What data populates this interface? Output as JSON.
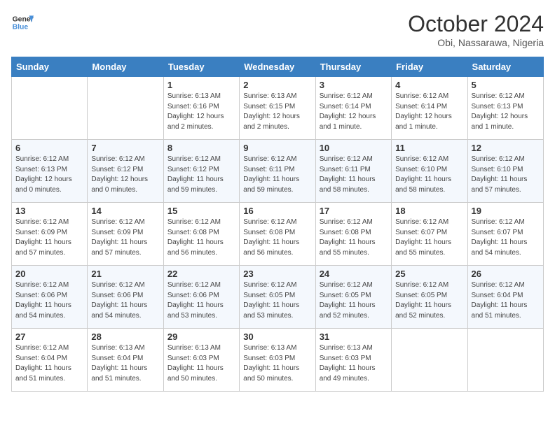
{
  "header": {
    "logo_line1": "General",
    "logo_line2": "Blue",
    "month": "October 2024",
    "location": "Obi, Nassarawa, Nigeria"
  },
  "days_of_week": [
    "Sunday",
    "Monday",
    "Tuesday",
    "Wednesday",
    "Thursday",
    "Friday",
    "Saturday"
  ],
  "weeks": [
    [
      {
        "day": "",
        "info": ""
      },
      {
        "day": "",
        "info": ""
      },
      {
        "day": "1",
        "info": "Sunrise: 6:13 AM\nSunset: 6:16 PM\nDaylight: 12 hours\nand 2 minutes."
      },
      {
        "day": "2",
        "info": "Sunrise: 6:13 AM\nSunset: 6:15 PM\nDaylight: 12 hours\nand 2 minutes."
      },
      {
        "day": "3",
        "info": "Sunrise: 6:12 AM\nSunset: 6:14 PM\nDaylight: 12 hours\nand 1 minute."
      },
      {
        "day": "4",
        "info": "Sunrise: 6:12 AM\nSunset: 6:14 PM\nDaylight: 12 hours\nand 1 minute."
      },
      {
        "day": "5",
        "info": "Sunrise: 6:12 AM\nSunset: 6:13 PM\nDaylight: 12 hours\nand 1 minute."
      }
    ],
    [
      {
        "day": "6",
        "info": "Sunrise: 6:12 AM\nSunset: 6:13 PM\nDaylight: 12 hours\nand 0 minutes."
      },
      {
        "day": "7",
        "info": "Sunrise: 6:12 AM\nSunset: 6:12 PM\nDaylight: 12 hours\nand 0 minutes."
      },
      {
        "day": "8",
        "info": "Sunrise: 6:12 AM\nSunset: 6:12 PM\nDaylight: 11 hours\nand 59 minutes."
      },
      {
        "day": "9",
        "info": "Sunrise: 6:12 AM\nSunset: 6:11 PM\nDaylight: 11 hours\nand 59 minutes."
      },
      {
        "day": "10",
        "info": "Sunrise: 6:12 AM\nSunset: 6:11 PM\nDaylight: 11 hours\nand 58 minutes."
      },
      {
        "day": "11",
        "info": "Sunrise: 6:12 AM\nSunset: 6:10 PM\nDaylight: 11 hours\nand 58 minutes."
      },
      {
        "day": "12",
        "info": "Sunrise: 6:12 AM\nSunset: 6:10 PM\nDaylight: 11 hours\nand 57 minutes."
      }
    ],
    [
      {
        "day": "13",
        "info": "Sunrise: 6:12 AM\nSunset: 6:09 PM\nDaylight: 11 hours\nand 57 minutes."
      },
      {
        "day": "14",
        "info": "Sunrise: 6:12 AM\nSunset: 6:09 PM\nDaylight: 11 hours\nand 57 minutes."
      },
      {
        "day": "15",
        "info": "Sunrise: 6:12 AM\nSunset: 6:08 PM\nDaylight: 11 hours\nand 56 minutes."
      },
      {
        "day": "16",
        "info": "Sunrise: 6:12 AM\nSunset: 6:08 PM\nDaylight: 11 hours\nand 56 minutes."
      },
      {
        "day": "17",
        "info": "Sunrise: 6:12 AM\nSunset: 6:08 PM\nDaylight: 11 hours\nand 55 minutes."
      },
      {
        "day": "18",
        "info": "Sunrise: 6:12 AM\nSunset: 6:07 PM\nDaylight: 11 hours\nand 55 minutes."
      },
      {
        "day": "19",
        "info": "Sunrise: 6:12 AM\nSunset: 6:07 PM\nDaylight: 11 hours\nand 54 minutes."
      }
    ],
    [
      {
        "day": "20",
        "info": "Sunrise: 6:12 AM\nSunset: 6:06 PM\nDaylight: 11 hours\nand 54 minutes."
      },
      {
        "day": "21",
        "info": "Sunrise: 6:12 AM\nSunset: 6:06 PM\nDaylight: 11 hours\nand 54 minutes."
      },
      {
        "day": "22",
        "info": "Sunrise: 6:12 AM\nSunset: 6:06 PM\nDaylight: 11 hours\nand 53 minutes."
      },
      {
        "day": "23",
        "info": "Sunrise: 6:12 AM\nSunset: 6:05 PM\nDaylight: 11 hours\nand 53 minutes."
      },
      {
        "day": "24",
        "info": "Sunrise: 6:12 AM\nSunset: 6:05 PM\nDaylight: 11 hours\nand 52 minutes."
      },
      {
        "day": "25",
        "info": "Sunrise: 6:12 AM\nSunset: 6:05 PM\nDaylight: 11 hours\nand 52 minutes."
      },
      {
        "day": "26",
        "info": "Sunrise: 6:12 AM\nSunset: 6:04 PM\nDaylight: 11 hours\nand 51 minutes."
      }
    ],
    [
      {
        "day": "27",
        "info": "Sunrise: 6:12 AM\nSunset: 6:04 PM\nDaylight: 11 hours\nand 51 minutes."
      },
      {
        "day": "28",
        "info": "Sunrise: 6:13 AM\nSunset: 6:04 PM\nDaylight: 11 hours\nand 51 minutes."
      },
      {
        "day": "29",
        "info": "Sunrise: 6:13 AM\nSunset: 6:03 PM\nDaylight: 11 hours\nand 50 minutes."
      },
      {
        "day": "30",
        "info": "Sunrise: 6:13 AM\nSunset: 6:03 PM\nDaylight: 11 hours\nand 50 minutes."
      },
      {
        "day": "31",
        "info": "Sunrise: 6:13 AM\nSunset: 6:03 PM\nDaylight: 11 hours\nand 49 minutes."
      },
      {
        "day": "",
        "info": ""
      },
      {
        "day": "",
        "info": ""
      }
    ]
  ]
}
